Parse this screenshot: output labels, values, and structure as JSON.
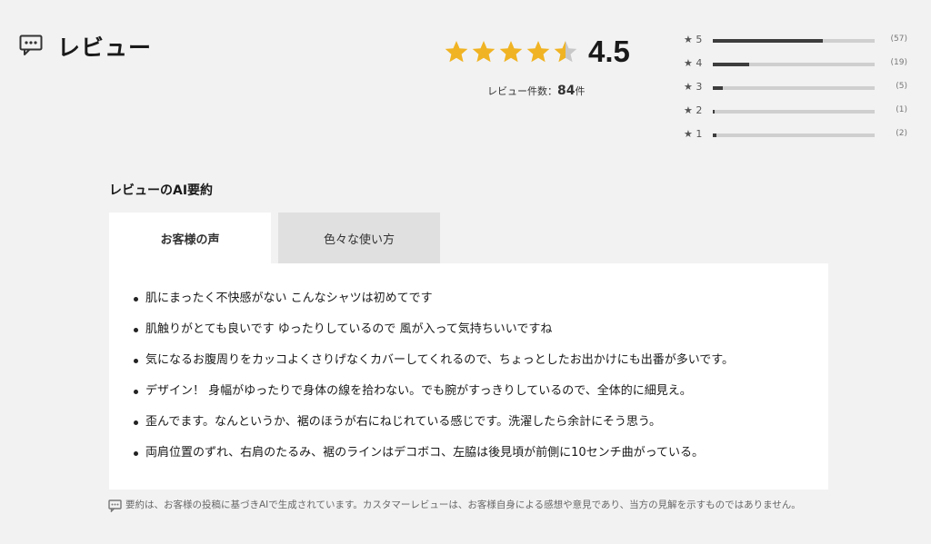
{
  "header": {
    "title": "レビュー",
    "icon": "chat-bubble-icon"
  },
  "summary": {
    "rating": 4.5,
    "rating_text": "4.5",
    "star_color": "#f0b323",
    "star_empty_color": "#c8c8c8",
    "count_label": "レビュー件数：",
    "count": "84",
    "count_unit": "件"
  },
  "distribution": [
    {
      "label": "★ 5",
      "count": 57,
      "count_text": "(57)"
    },
    {
      "label": "★ 4",
      "count": 19,
      "count_text": "(19)"
    },
    {
      "label": "★ 3",
      "count": 5,
      "count_text": "(5)"
    },
    {
      "label": "★ 2",
      "count": 1,
      "count_text": "(1)"
    },
    {
      "label": "★ 1",
      "count": 2,
      "count_text": "(2)"
    }
  ],
  "ai_summary": {
    "title": "レビューのAI要約",
    "tabs": [
      {
        "label": "お客様の声",
        "active": true
      },
      {
        "label": "色々な使い方",
        "active": false
      }
    ],
    "items": [
      "肌にまったく不快感がない こんなシャツは初めてです",
      "肌触りがとても良いです ゆったりしているので 風が入って気持ちいいですね",
      "気になるお腹周りをカッコよくさりげなくカバーしてくれるので、ちょっとしたお出かけにも出番が多いです。",
      "デザイン！ 身幅がゆったりで身体の線を拾わない。でも腕がすっきりしているので、全体的に細見え。",
      "歪んでます。なんというか、裾のほうが右にねじれている感じです。洗濯したら余計にそう思う。",
      "両肩位置のずれ、右肩のたるみ、裾のラインはデコボコ、左脇は後見頃が前側に10センチ曲がっている。"
    ]
  },
  "disclaimer": "要約は、お客様の投稿に基づきAIで生成されています。カスタマーレビューは、お客様自身による感想や意見であり、当方の見解を示すものではありません。"
}
